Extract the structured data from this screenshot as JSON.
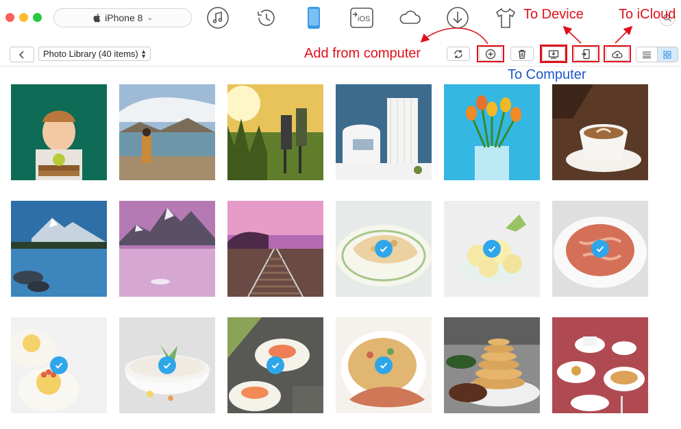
{
  "device": {
    "name": "iPhone 8",
    "icon": "apple-icon"
  },
  "nav_icons": [
    "music-icon",
    "history-icon",
    "phone-icon",
    "ios-transfer-icon",
    "cloud-icon",
    "download-icon",
    "tshirt-icon"
  ],
  "nav_ios_text": "iOS",
  "library": {
    "label": "Photo Library (40 items)"
  },
  "toolbar": [
    "refresh-icon",
    "add-icon",
    "trash-icon",
    "to-computer-icon",
    "to-device-icon",
    "to-icloud-icon",
    "list-view-icon",
    "grid-view-icon"
  ],
  "annotations": {
    "add_from_computer": "Add from computer",
    "to_computer": "To Computer",
    "to_device": "To Device",
    "to_icloud": "To iCloud"
  },
  "annotation_colors": {
    "red": "#e0101a",
    "blue": "#1f55c9"
  },
  "accent": "#2fa6ea",
  "photos": [
    {
      "subject": "boy-with-books",
      "selected": false
    },
    {
      "subject": "woman-by-lake",
      "selected": false
    },
    {
      "subject": "hikers-in-field",
      "selected": false
    },
    {
      "subject": "white-armchair-room",
      "selected": false
    },
    {
      "subject": "tulips-in-vase",
      "selected": false
    },
    {
      "subject": "coffee-cup",
      "selected": false
    },
    {
      "subject": "mountain-lake",
      "selected": false
    },
    {
      "subject": "purple-mountains",
      "selected": false
    },
    {
      "subject": "railway-tracks",
      "selected": false
    },
    {
      "subject": "pastry-plate",
      "selected": true
    },
    {
      "subject": "butter-swirls",
      "selected": true
    },
    {
      "subject": "soup-bowl",
      "selected": true
    },
    {
      "subject": "deviled-eggs",
      "selected": true
    },
    {
      "subject": "rice-bowl",
      "selected": true
    },
    {
      "subject": "sushi-rolls",
      "selected": true
    },
    {
      "subject": "roast-dish",
      "selected": true
    },
    {
      "subject": "pancake-stack",
      "selected": false
    },
    {
      "subject": "table-setting",
      "selected": false
    }
  ]
}
